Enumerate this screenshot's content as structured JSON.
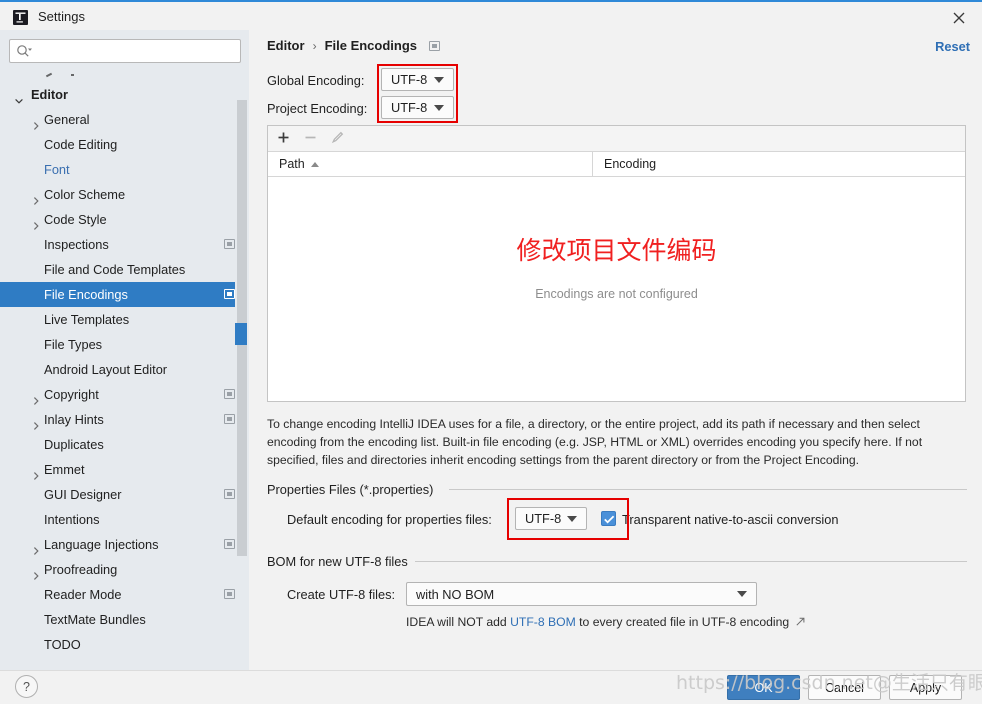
{
  "window": {
    "title": "Settings",
    "app_icon": "intellij-idea-icon",
    "close_icon": "close-icon",
    "accent_color": "#2f89d8"
  },
  "sidebar": {
    "search": {
      "placeholder": "",
      "value": "",
      "icon": "search-icon"
    },
    "tree": [
      {
        "label": "Editor",
        "level": 0,
        "arrow": "chevron-down",
        "badge": false,
        "selected": false,
        "link": false
      },
      {
        "label": "General",
        "level": 1,
        "arrow": "chevron-right",
        "badge": false,
        "selected": false,
        "link": false
      },
      {
        "label": "Code Editing",
        "level": 1,
        "arrow": "none",
        "badge": false,
        "selected": false,
        "link": false
      },
      {
        "label": "Font",
        "level": 1,
        "arrow": "none",
        "badge": false,
        "selected": false,
        "link": true
      },
      {
        "label": "Color Scheme",
        "level": 1,
        "arrow": "chevron-right",
        "badge": false,
        "selected": false,
        "link": false
      },
      {
        "label": "Code Style",
        "level": 1,
        "arrow": "chevron-right",
        "badge": false,
        "selected": false,
        "link": false
      },
      {
        "label": "Inspections",
        "level": 1,
        "arrow": "none",
        "badge": true,
        "selected": false,
        "link": false
      },
      {
        "label": "File and Code Templates",
        "level": 1,
        "arrow": "none",
        "badge": false,
        "selected": false,
        "link": false
      },
      {
        "label": "File Encodings",
        "level": 1,
        "arrow": "none",
        "badge": true,
        "selected": true,
        "link": false
      },
      {
        "label": "Live Templates",
        "level": 1,
        "arrow": "none",
        "badge": false,
        "selected": false,
        "link": false
      },
      {
        "label": "File Types",
        "level": 1,
        "arrow": "none",
        "badge": false,
        "selected": false,
        "link": false
      },
      {
        "label": "Android Layout Editor",
        "level": 1,
        "arrow": "none",
        "badge": false,
        "selected": false,
        "link": false
      },
      {
        "label": "Copyright",
        "level": 1,
        "arrow": "chevron-right",
        "badge": true,
        "selected": false,
        "link": false
      },
      {
        "label": "Inlay Hints",
        "level": 1,
        "arrow": "chevron-right",
        "badge": true,
        "selected": false,
        "link": false
      },
      {
        "label": "Duplicates",
        "level": 1,
        "arrow": "none",
        "badge": false,
        "selected": false,
        "link": false
      },
      {
        "label": "Emmet",
        "level": 1,
        "arrow": "chevron-right",
        "badge": false,
        "selected": false,
        "link": false
      },
      {
        "label": "GUI Designer",
        "level": 1,
        "arrow": "none",
        "badge": true,
        "selected": false,
        "link": false
      },
      {
        "label": "Intentions",
        "level": 1,
        "arrow": "none",
        "badge": false,
        "selected": false,
        "link": false
      },
      {
        "label": "Language Injections",
        "level": 1,
        "arrow": "chevron-right",
        "badge": true,
        "selected": false,
        "link": false
      },
      {
        "label": "Proofreading",
        "level": 1,
        "arrow": "chevron-right",
        "badge": false,
        "selected": false,
        "link": false
      },
      {
        "label": "Reader Mode",
        "level": 1,
        "arrow": "none",
        "badge": true,
        "selected": false,
        "link": false
      },
      {
        "label": "TextMate Bundles",
        "level": 1,
        "arrow": "none",
        "badge": false,
        "selected": false,
        "link": false
      },
      {
        "label": "TODO",
        "level": 1,
        "arrow": "none",
        "badge": false,
        "selected": false,
        "link": false
      }
    ]
  },
  "main": {
    "breadcrumb": {
      "parent": "Editor",
      "separator": "›",
      "current": "File Encodings",
      "badge": "project-scope-badge"
    },
    "reset_label": "Reset",
    "global_encoding": {
      "label": "Global Encoding:",
      "value": "UTF-8"
    },
    "project_encoding": {
      "label": "Project Encoding:",
      "value": "UTF-8"
    },
    "table": {
      "toolbar": {
        "add_icon": "plus-icon",
        "remove_icon": "minus-icon",
        "edit_icon": "pencil-icon"
      },
      "columns": [
        "Path",
        "Encoding"
      ],
      "sort_column": "Path",
      "sort_direction": "ascending",
      "rows": [],
      "empty_message": "Encodings are not configured",
      "annotation_cn": "修改项目文件编码"
    },
    "description": "To change encoding IntelliJ IDEA uses for a file, a directory, or the entire project, add its path if necessary and then select encoding from the encoding list. Built-in file encoding (e.g. JSP, HTML or XML) overrides encoding you specify here. If not specified, files and directories inherit encoding settings from the parent directory or from the Project Encoding.",
    "properties_group": {
      "title": "Properties Files (*.properties)",
      "default_encoding_label": "Default encoding for properties files:",
      "default_encoding_value": "UTF-8",
      "transparent_label": "Transparent native-to-ascii conversion",
      "transparent_checked": true
    },
    "bom_group": {
      "title": "BOM for new UTF-8 files",
      "create_label": "Create UTF-8 files:",
      "create_value": "with NO BOM",
      "hint_prefix": "IDEA will NOT add ",
      "hint_link": "UTF-8 BOM",
      "hint_suffix": " to every created file in UTF-8 encoding",
      "hint_external_icon": "external-link-icon"
    },
    "annotation_color": "#e60000"
  },
  "footer": {
    "help_label": "?",
    "ok_label": "OK",
    "cancel_label": "Cancel",
    "apply_label": "Apply"
  },
  "watermark": {
    "text": "https://blog.csdn.net@生活只有眼前目标"
  }
}
